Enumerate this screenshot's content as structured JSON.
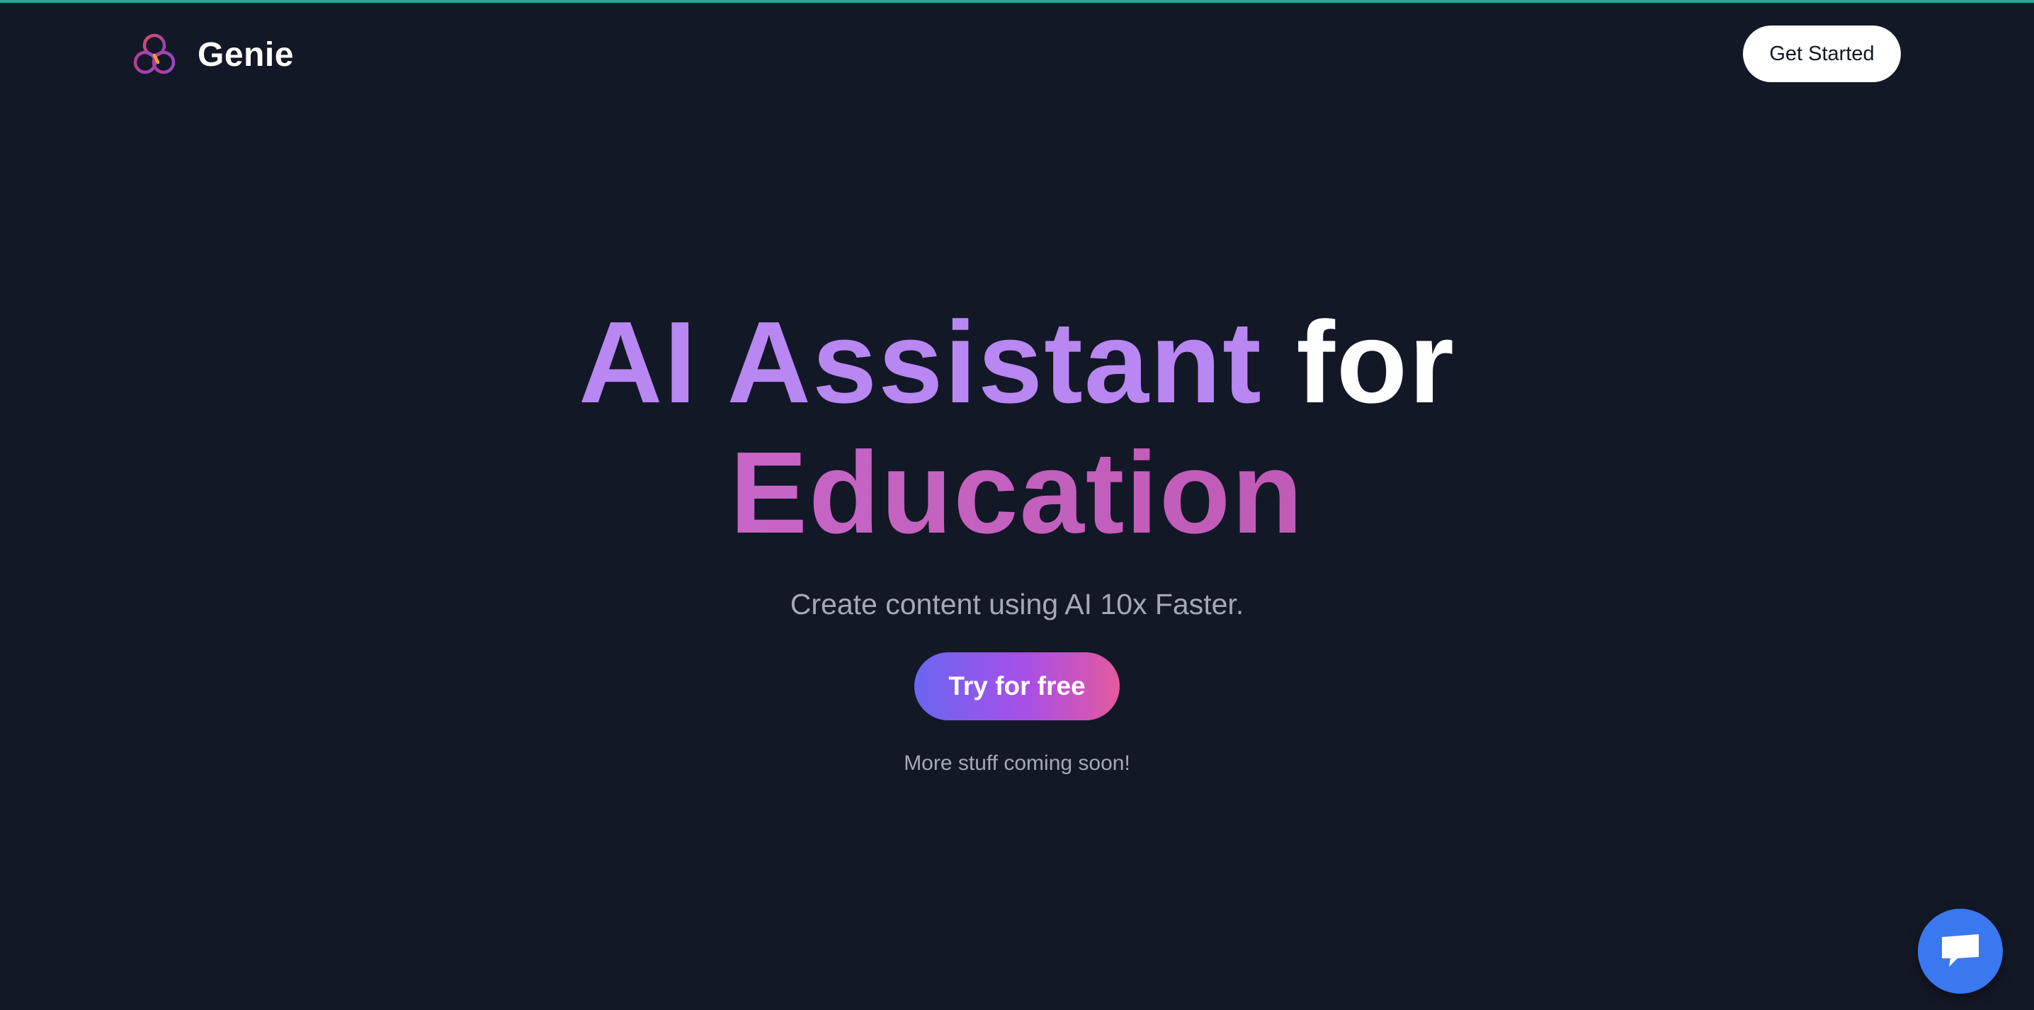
{
  "brand": {
    "name": "Genie",
    "logo_icon": "interlocking-rings-logo-icon"
  },
  "nav": {
    "get_started_label": "Get Started"
  },
  "hero": {
    "title_part1": "AI Assistant",
    "title_part2": "for",
    "title_part3": "Education",
    "subtitle": "Create content using AI 10x Faster.",
    "cta_label": "Try for free",
    "note": "More stuff coming soon!"
  },
  "chat": {
    "icon": "chat-bubble-icon"
  },
  "colors": {
    "background": "#131826",
    "accent_bar": "#2aa79b",
    "title_purple": "#b887f2",
    "title_pink": "#c35dc0",
    "cta_gradient_start": "#6a66f2",
    "cta_gradient_end": "#e45a9e",
    "chat_button": "#3a78f0"
  }
}
